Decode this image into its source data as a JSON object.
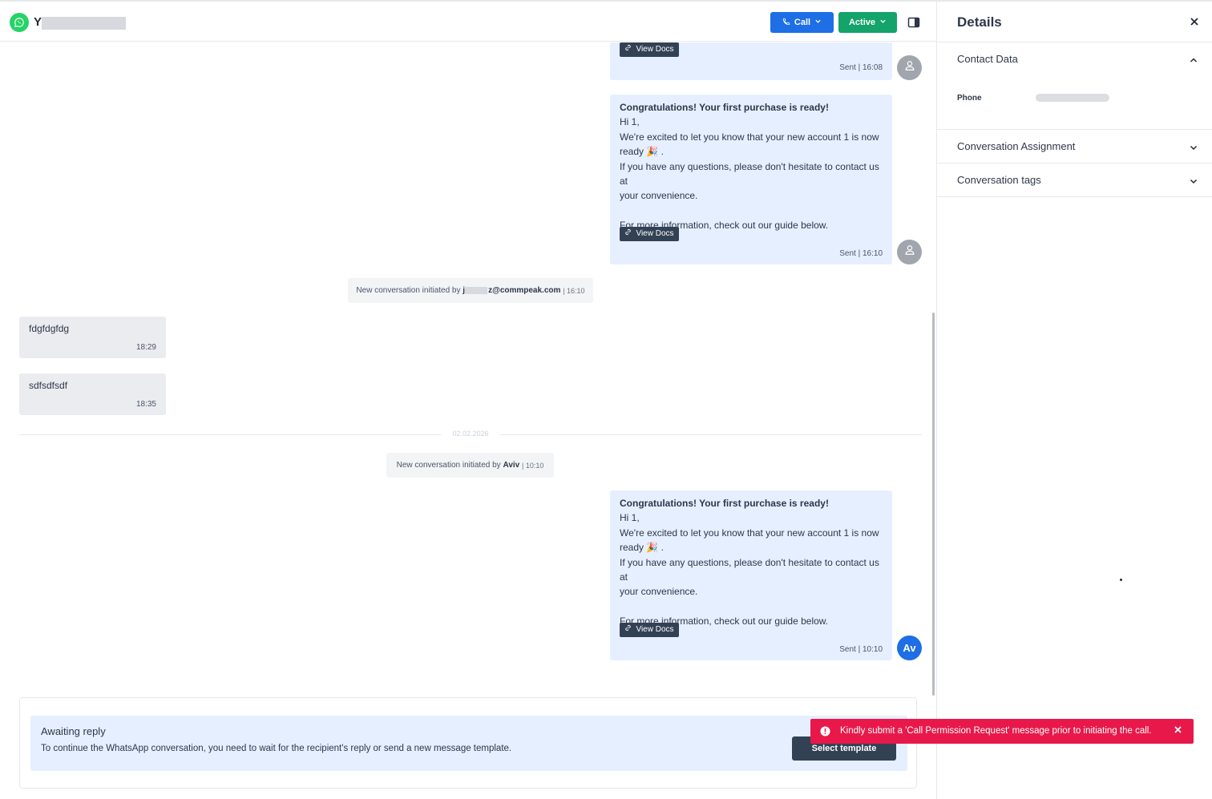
{
  "header": {
    "contact_initial": "Y",
    "call_label": "Call",
    "status_label": "Active"
  },
  "messages": {
    "msg1": {
      "view_docs": "View Docs",
      "meta": "Sent | 16:08"
    },
    "msg2": {
      "title": "Congratulations! Your first purchase is ready!",
      "greeting": "Hi 1,",
      "line1": "We're excited to let you know that your new account 1 is now",
      "line2": "ready 🎉 .",
      "line3": "If you have any questions, please don't hesitate to contact us at",
      "line4": "your convenience.",
      "line5": "For more information, check out our guide below.",
      "view_docs": "View Docs",
      "meta": "Sent | 16:10"
    },
    "system1": {
      "prefix": "New conversation initiated by",
      "initial": "j",
      "email_suffix": "z@commpeak.com",
      "time": "| 16:10"
    },
    "incoming1": {
      "text": "fdgfdgfdg",
      "time": "18:29"
    },
    "incoming2": {
      "text": "sdfsdfsdf",
      "time": "18:35"
    },
    "date_divider": "02.02.2026",
    "system2": {
      "prefix": "New conversation initiated by",
      "name": "Aviv",
      "time": "| 10:10"
    },
    "msg3": {
      "title": "Congratulations! Your first purchase is ready!",
      "greeting": "Hi 1,",
      "line1": "We're excited to let you know that your new account 1 is now",
      "line2": "ready 🎉 .",
      "line3": "If you have any questions, please don't hesitate to contact us at",
      "line4": "your convenience.",
      "line5": "For more information, check out our guide below.",
      "view_docs": "View Docs",
      "meta": "Sent | 10:10",
      "avatar": "Av"
    }
  },
  "composer": {
    "heading": "Awaiting reply",
    "text": "To continue the WhatsApp conversation, you need to wait for the recipient's reply or send a new message template.",
    "button": "Select template"
  },
  "details": {
    "title": "Details",
    "contact_data": "Contact Data",
    "phone_label": "Phone",
    "assignment": "Conversation Assignment",
    "tags": "Conversation tags"
  },
  "toast": {
    "message": "Kindly submit a 'Call Permission Request' message prior to initiating the call."
  },
  "colors": {
    "primary_blue": "#1e6ee6",
    "active_green": "#13a36b",
    "bubble_out": "#e6efff",
    "bubble_in": "#ebecf0",
    "dark_button": "#334155",
    "toast_red": "#e8194a",
    "whatsapp_green": "#25d366"
  }
}
